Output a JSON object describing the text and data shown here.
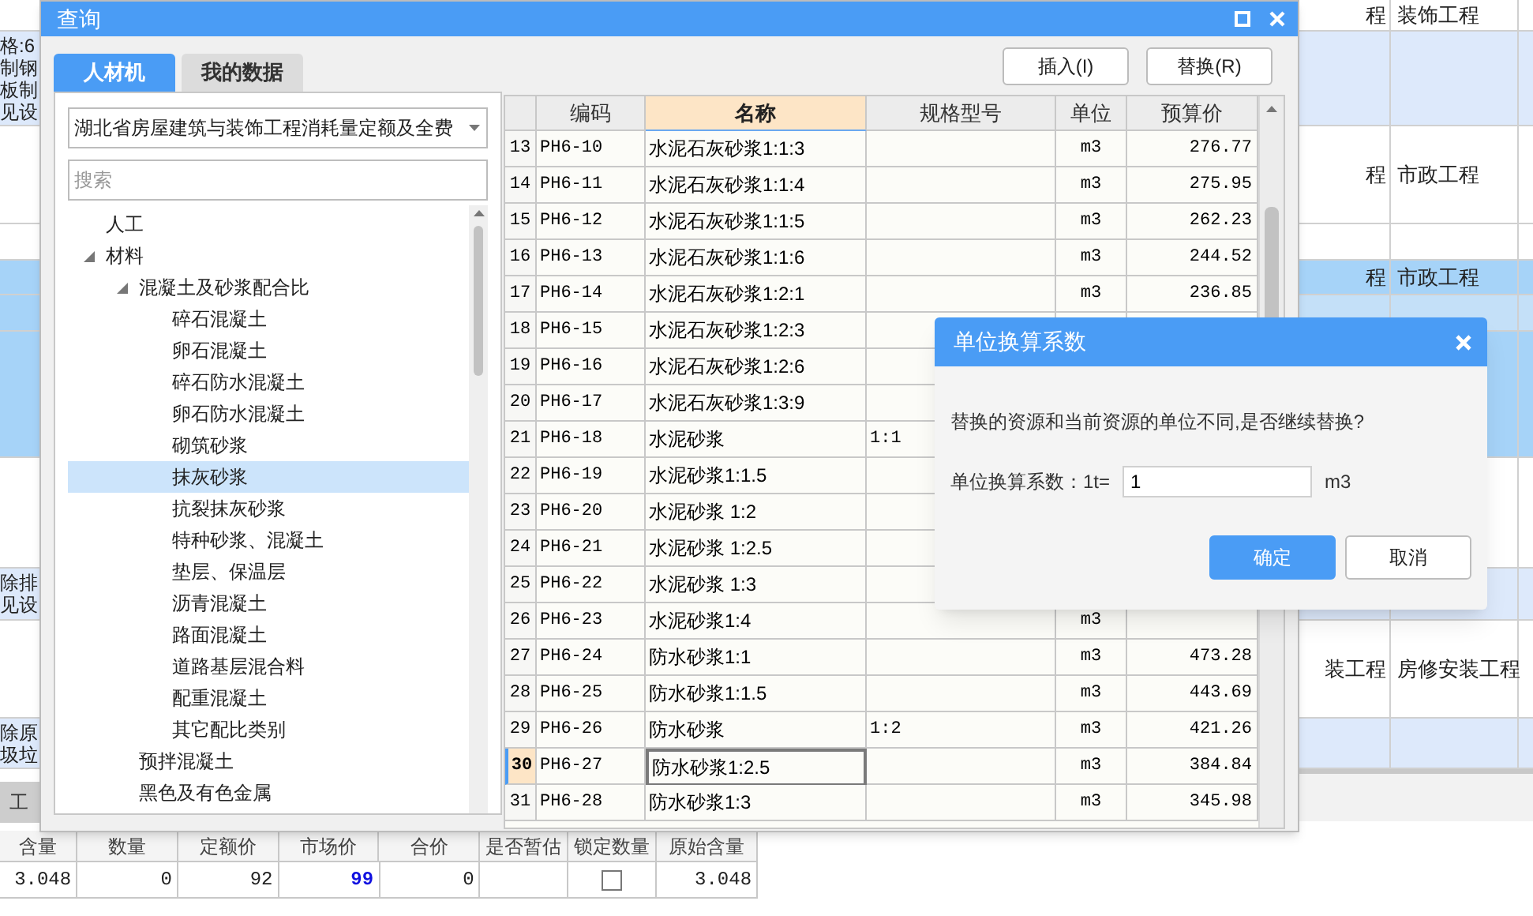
{
  "background": {
    "left_rows": [
      {
        "kind": "white"
      },
      {
        "kind": "light",
        "lines": [
          "格:6",
          "制钢",
          "板制",
          "见设"
        ]
      },
      {
        "kind": "white"
      },
      {
        "kind": "white"
      },
      {
        "kind": "blue"
      },
      {
        "kind": "blue"
      },
      {
        "kind": "blue"
      },
      {
        "kind": "white"
      },
      {
        "kind": "light",
        "lines": [
          "除排",
          "见设"
        ]
      },
      {
        "kind": "white"
      },
      {
        "kind": "light",
        "lines": [
          "除原",
          "圾垃"
        ]
      }
    ],
    "right_rows": [
      {
        "kind": "white",
        "cells": [
          "程",
          "装饰工程"
        ]
      },
      {
        "kind": "light",
        "cells": []
      },
      {
        "kind": "white",
        "cells": [
          "程",
          "市政工程"
        ]
      },
      {
        "kind": "white",
        "cells": []
      },
      {
        "kind": "blue",
        "cells": [
          "程",
          "市政工程"
        ]
      },
      {
        "kind": "faded",
        "cells": []
      },
      {
        "kind": "blue",
        "cells": []
      },
      {
        "kind": "white",
        "cells": []
      },
      {
        "kind": "light",
        "cells": []
      },
      {
        "kind": "white",
        "cells": [
          "装工程",
          "房修安装工程"
        ]
      },
      {
        "kind": "light",
        "cells": []
      }
    ],
    "bottom_tab": "工",
    "bottom_table": {
      "columns": [
        "含量",
        "数量",
        "定额价",
        "市场价",
        "合价",
        "是否暂估",
        "锁定数量",
        "原始含量"
      ],
      "rows": [
        {
          "content": "3.048",
          "quantity": "0",
          "quota_price": "92",
          "market_price": "99",
          "total": "0",
          "locked": false,
          "original": "3.048"
        }
      ]
    }
  },
  "query_window": {
    "title": "查询",
    "tabs": [
      {
        "label": "人材机",
        "selected": true
      },
      {
        "label": "我的数据",
        "selected": false
      }
    ],
    "library_select": "湖北省房屋建筑与装饰工程消耗量定额及全费",
    "search": {
      "placeholder": "搜索"
    },
    "tree": [
      {
        "label": "人工",
        "selected": false
      },
      {
        "label": "材料",
        "selected": false,
        "expanded": true,
        "children": [
          {
            "label": "混凝土及砂浆配合比",
            "selected": false,
            "expanded": true,
            "children": [
              {
                "label": "碎石混凝土",
                "selected": false
              },
              {
                "label": "卵石混凝土",
                "selected": false
              },
              {
                "label": "碎石防水混凝土",
                "selected": false
              },
              {
                "label": "卵石防水混凝土",
                "selected": false
              },
              {
                "label": "砌筑砂浆",
                "selected": false
              },
              {
                "label": "抹灰砂浆",
                "selected": true
              },
              {
                "label": "抗裂抹灰砂浆",
                "selected": false
              },
              {
                "label": "特种砂浆、混凝土",
                "selected": false
              },
              {
                "label": "垫层、保温层",
                "selected": false
              },
              {
                "label": "沥青混凝土",
                "selected": false
              },
              {
                "label": "路面混凝土",
                "selected": false
              },
              {
                "label": "道路基层混合料",
                "selected": false
              },
              {
                "label": "配重混凝土",
                "selected": false
              },
              {
                "label": "其它配比类别",
                "selected": false
              }
            ]
          },
          {
            "label": "预拌混凝土",
            "selected": false
          },
          {
            "label": "黑色及有色金属",
            "selected": false
          }
        ]
      }
    ],
    "buttons": [
      "插入(I)",
      "替换(R)"
    ],
    "grid": {
      "columns": [
        {
          "label": "编码",
          "selected": false
        },
        {
          "label": "名称",
          "selected": true
        },
        {
          "label": "规格型号",
          "selected": false
        },
        {
          "label": "单位",
          "selected": false
        },
        {
          "label": "预算价",
          "selected": false
        }
      ],
      "rows": [
        {
          "num": "13",
          "code": "PH6-10",
          "name": "水泥石灰砂浆1:1:3",
          "unit": "m3",
          "price": "276.77",
          "selected": false
        },
        {
          "num": "14",
          "code": "PH6-11",
          "name": "水泥石灰砂浆1:1:4",
          "unit": "m3",
          "price": "275.95",
          "selected": false
        },
        {
          "num": "15",
          "code": "PH6-12",
          "name": "水泥石灰砂浆1:1:5",
          "unit": "m3",
          "price": "262.23",
          "selected": false
        },
        {
          "num": "16",
          "code": "PH6-13",
          "name": "水泥石灰砂浆1:1:6",
          "unit": "m3",
          "price": "244.52",
          "selected": false
        },
        {
          "num": "17",
          "code": "PH6-14",
          "name": "水泥石灰砂浆1:2:1",
          "unit": "m3",
          "price": "236.85",
          "selected": false
        },
        {
          "num": "18",
          "code": "PH6-15",
          "name": "水泥石灰砂浆1:2:3",
          "selected": false
        },
        {
          "num": "19",
          "code": "PH6-16",
          "name": "水泥石灰砂浆1:2:6",
          "selected": false
        },
        {
          "num": "20",
          "code": "PH6-17",
          "name": "水泥石灰砂浆1:3:9",
          "selected": false
        },
        {
          "num": "21",
          "code": "PH6-18",
          "name": "水泥砂浆",
          "spec": "1:1",
          "selected": false
        },
        {
          "num": "22",
          "code": "PH6-19",
          "name": "水泥砂浆1:1.5",
          "selected": false
        },
        {
          "num": "23",
          "code": "PH6-20",
          "name": "水泥砂浆 1:2",
          "selected": false
        },
        {
          "num": "24",
          "code": "PH6-21",
          "name": "水泥砂浆 1:2.5",
          "selected": false
        },
        {
          "num": "25",
          "code": "PH6-22",
          "name": "水泥砂浆 1:3",
          "selected": false
        },
        {
          "num": "26",
          "code": "PH6-23",
          "name": "水泥砂浆1:4",
          "unit": "m3",
          "selected": false
        },
        {
          "num": "27",
          "code": "PH6-24",
          "name": "防水砂浆1:1",
          "unit": "m3",
          "price": "473.28",
          "selected": false
        },
        {
          "num": "28",
          "code": "PH6-25",
          "name": "防水砂浆1:1.5",
          "unit": "m3",
          "price": "443.69",
          "selected": false
        },
        {
          "num": "29",
          "code": "PH6-26",
          "name": "防水砂浆",
          "spec": "1:2",
          "unit": "m3",
          "price": "421.26",
          "selected": false
        },
        {
          "num": "30",
          "code": "PH6-27",
          "name": "防水砂浆1:2.5",
          "unit": "m3",
          "price": "384.84",
          "selected": true
        },
        {
          "num": "31",
          "code": "PH6-28",
          "name": "防水砂浆1:3",
          "unit": "m3",
          "price": "345.98",
          "selected": false
        }
      ]
    }
  },
  "dialog": {
    "title": "单位换算系数",
    "message": "替换的资源和当前资源的单位不同,是否继续替换?",
    "field_label": "单位换算系数：1t=",
    "value": "1",
    "unit": "m3",
    "buttons": [
      {
        "label": "确定",
        "kind": "primary"
      },
      {
        "label": "取消",
        "kind": "secondary"
      }
    ]
  }
}
